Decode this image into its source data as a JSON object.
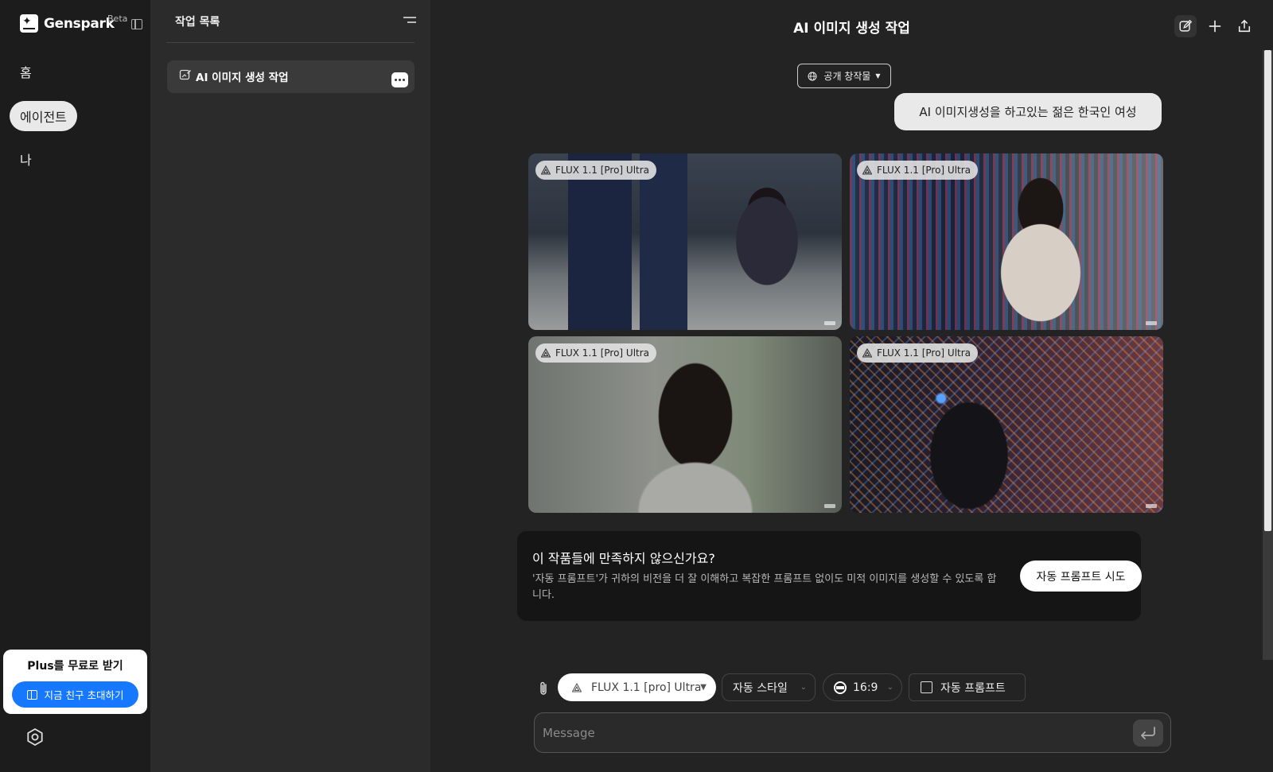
{
  "app": {
    "name": "Genspark",
    "badge": "Beta"
  },
  "nav": {
    "items": [
      {
        "label": "홈",
        "active": false
      },
      {
        "label": "에이전트",
        "active": true
      },
      {
        "label": "나",
        "active": false
      }
    ],
    "promo": {
      "title": "Plus를 무료로 받기",
      "button": "지금 친구 초대하기"
    }
  },
  "tasks": {
    "title": "작업 목록",
    "items": [
      {
        "label": "AI 이미지 생성 작업"
      }
    ]
  },
  "main": {
    "title": "AI 이미지 생성 작업",
    "visibility": "공개 창작물",
    "user_prompt": "AI 이미지생성을 하고있는 젊은 한국인 여성",
    "images": [
      {
        "model": "FLUX 1.1 [Pro] Ultra"
      },
      {
        "model": "FLUX 1.1 [Pro] Ultra"
      },
      {
        "model": "FLUX 1.1 [Pro] Ultra"
      },
      {
        "model": "FLUX 1.1 [Pro] Ultra"
      }
    ],
    "auto_prompt_card": {
      "title": "이 작품들에 만족하지 않으신가요?",
      "description": "'자동 프롬프트'가 귀하의 비전을 더 잘 이해하고 복잡한 프롬프트 없이도 미적 이미지를 생성할 수 있도록 합니다.",
      "button": "자동 프롬프트 시도"
    },
    "controls": {
      "model": "FLUX 1.1 [pro] Ultra",
      "style": "자동 스타일",
      "ratio": "16:9",
      "auto_prompt": "자동 프롬프트"
    },
    "message": {
      "placeholder": "Message"
    }
  },
  "colors": {
    "accent": "#1677ff",
    "background": "#232323"
  }
}
